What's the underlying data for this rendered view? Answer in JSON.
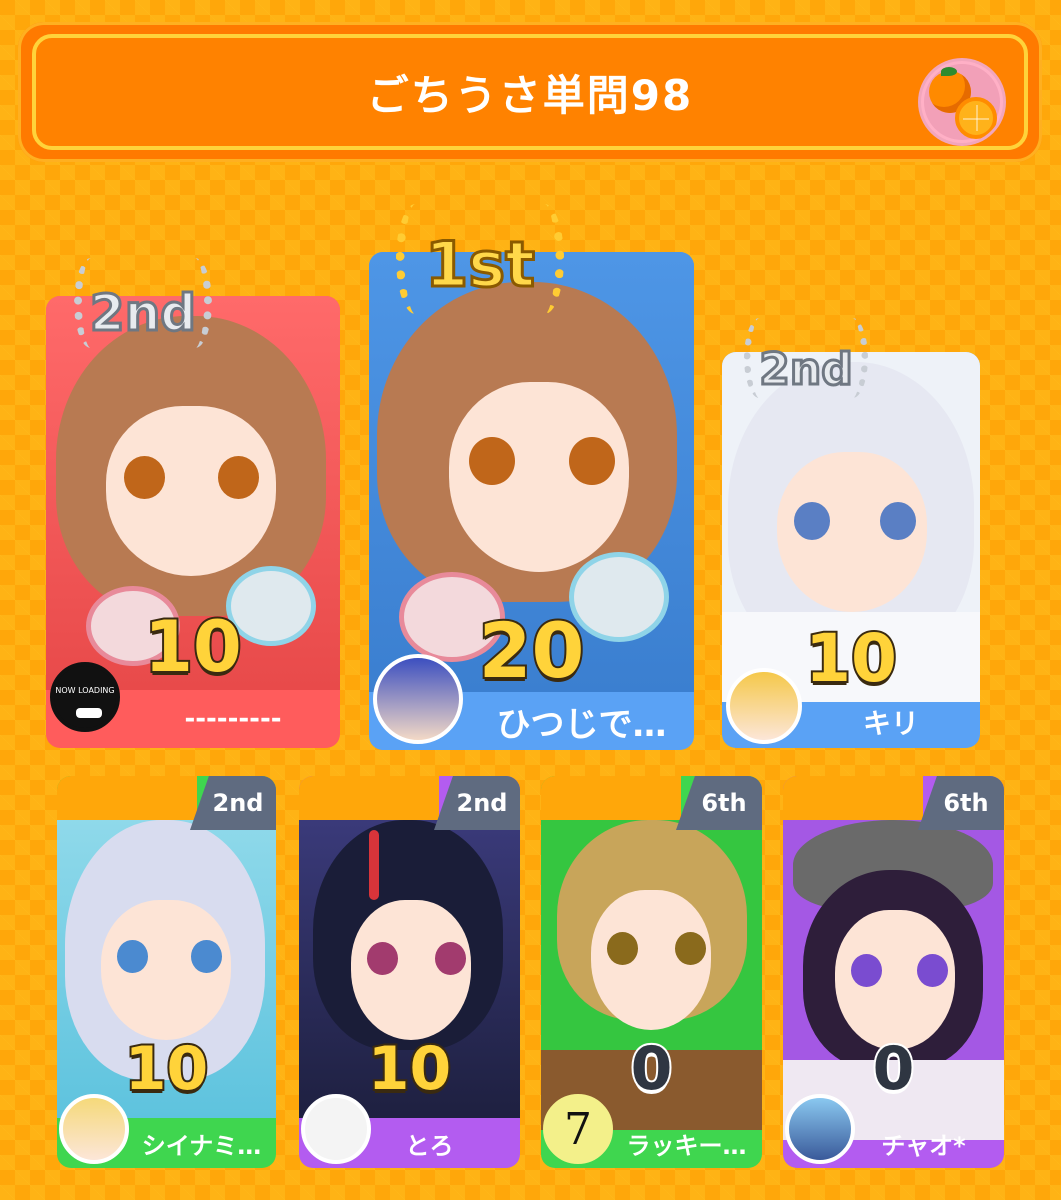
{
  "header": {
    "title": "ごちうさ単問98",
    "badge_icon": "orange-icon"
  },
  "podium": [
    {
      "medal": "2nd",
      "score": "10",
      "name": "---------",
      "avatar_text": "NOW LOADING",
      "bg": "#ff5c5c"
    },
    {
      "medal": "1st",
      "score": "20",
      "name": "ひつじで…",
      "bg": "#5aa2f5"
    },
    {
      "medal": "2nd",
      "score": "10",
      "name": "キリ",
      "bg": "#5aa2f5"
    }
  ],
  "others": [
    {
      "rank": "2nd",
      "score": "10",
      "name": "シイナミ…",
      "bg": "#3fd64f"
    },
    {
      "rank": "2nd",
      "score": "10",
      "name": "とろ",
      "bg": "#b35cf0"
    },
    {
      "rank": "6th",
      "score": "0",
      "name": "ラッキー…",
      "avatar_text": "7",
      "bg": "#3fd64f"
    },
    {
      "rank": "6th",
      "score": "0",
      "name": "チャオ*",
      "bg": "#b35cf0"
    }
  ]
}
